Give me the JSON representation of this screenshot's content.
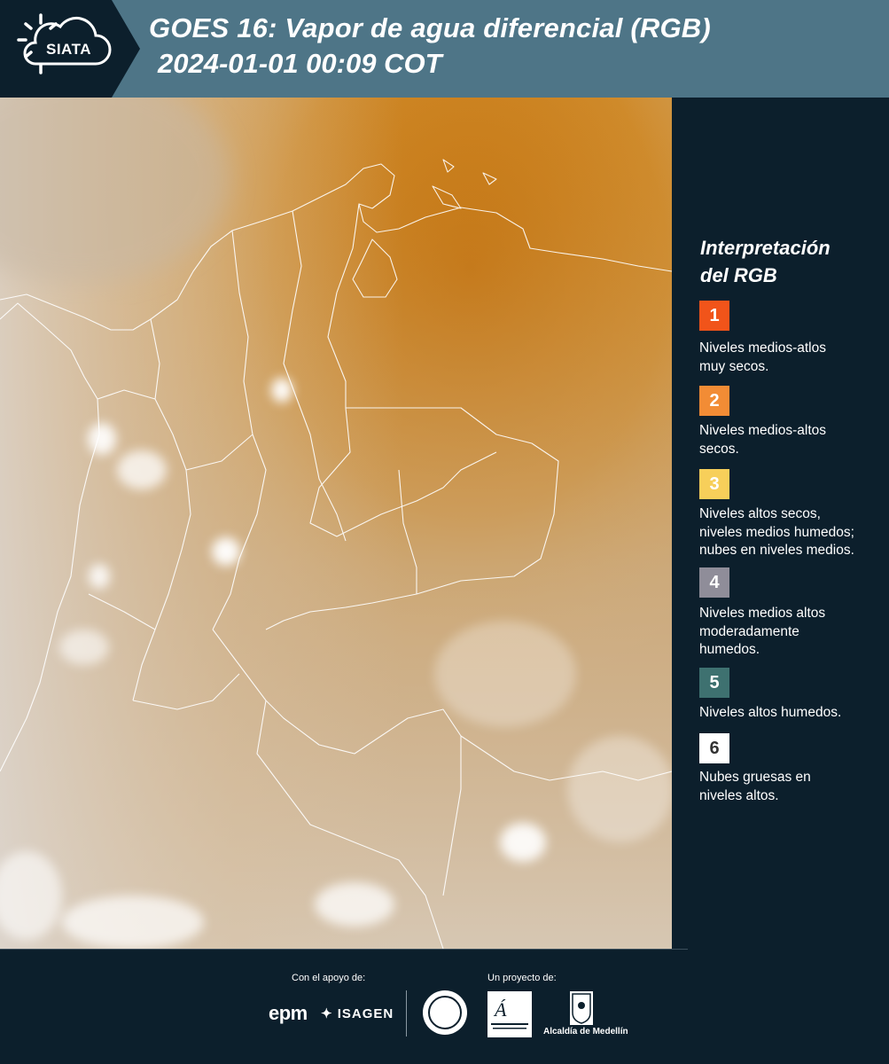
{
  "header": {
    "logo_text": "SIATA",
    "title_line1": "GOES 16: Vapor de agua diferencial (RGB)",
    "title_line2": "2024-01-01 00:09 COT",
    "background_color": "#4e7587"
  },
  "legend": {
    "title_line1": "Interpretación",
    "title_line2": "del RGB",
    "items": [
      {
        "number": "1",
        "color": "#f1541a",
        "text_line1": "Niveles medios-atlos",
        "text_line2": "muy secos.",
        "text_line3": ""
      },
      {
        "number": "2",
        "color": "#f28c35",
        "text_line1": "Niveles medios-altos",
        "text_line2": "secos.",
        "text_line3": ""
      },
      {
        "number": "3",
        "color": "#f7cf5a",
        "text_line1": "Niveles altos secos,",
        "text_line2": "niveles medios humedos;",
        "text_line3": "nubes en niveles medios."
      },
      {
        "number": "4",
        "color": "#8f8d99",
        "text_line1": "Niveles medios altos",
        "text_line2": "moderadamente",
        "text_line3": "humedos."
      },
      {
        "number": "5",
        "color": "#3e7170",
        "text_line1": "Niveles altos humedos.",
        "text_line2": "",
        "text_line3": ""
      },
      {
        "number": "6",
        "color": "#ffffff",
        "text_line1": "Nubes gruesas en",
        "text_line2": "niveles altos.",
        "text_line3": ""
      }
    ]
  },
  "footer": {
    "support_label": "Con el apoyo de:",
    "project_label": "Un proyecto de:",
    "sponsor1": "epm",
    "sponsor2": "ISAGEN",
    "partner_alcaldia": "Alcaldía de Medellín"
  }
}
